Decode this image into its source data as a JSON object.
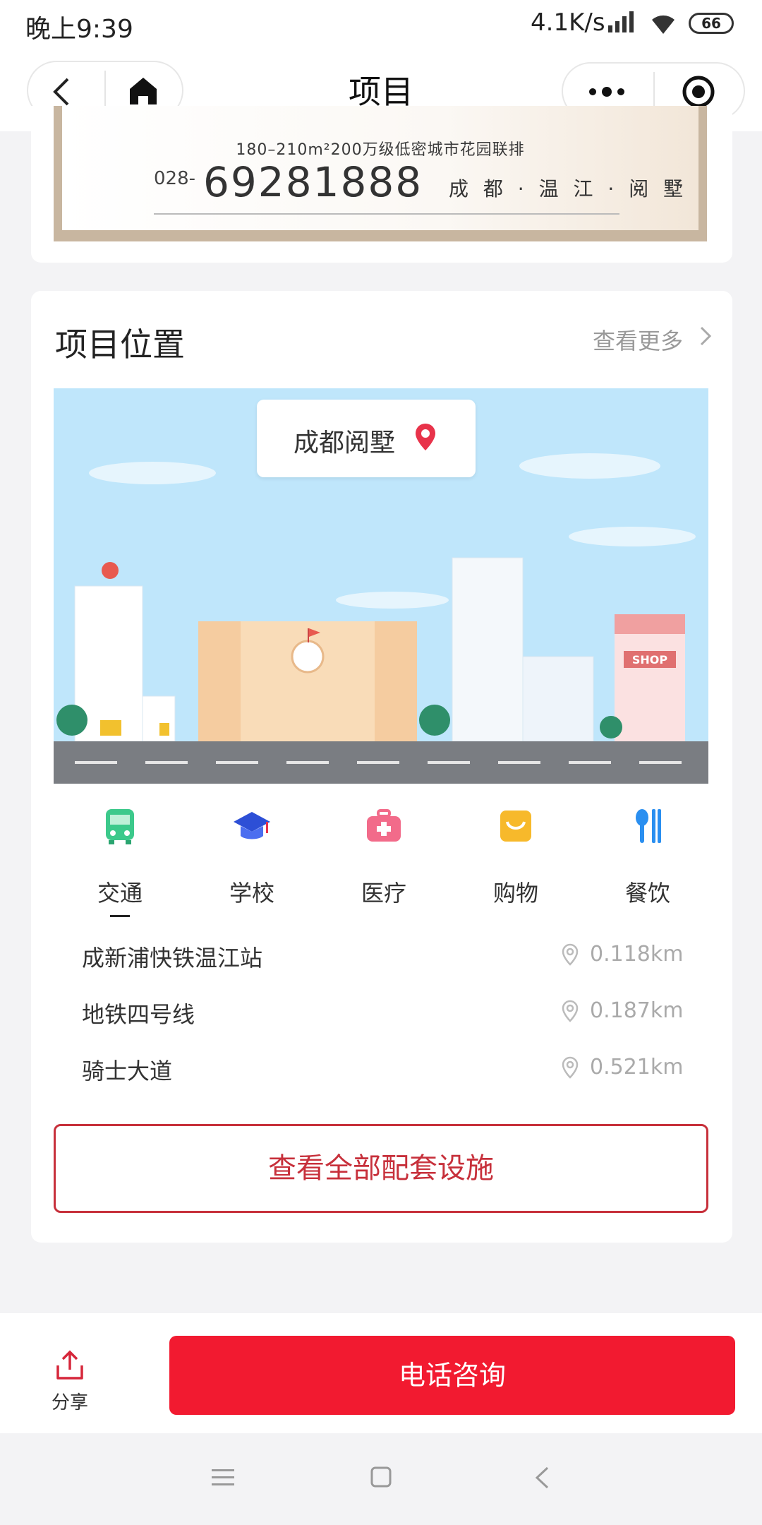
{
  "status_bar": {
    "time": "晚上9:39",
    "speed": "4.1K/s",
    "battery": "66"
  },
  "nav": {
    "title": "项目"
  },
  "banner": {
    "line1": "180–210m²200万级低密城市花园联排",
    "phone_prefix": "028-",
    "phone_main": "69281888",
    "location_text": "成 都 · 温 江 · 阅 墅"
  },
  "location_section": {
    "title": "项目位置",
    "more_label": "查看更多",
    "place_name": "成都阅墅",
    "shop_sign": "SHOP",
    "categories": [
      {
        "label": "交通",
        "icon": "bus-icon"
      },
      {
        "label": "学校",
        "icon": "graduation-cap-icon"
      },
      {
        "label": "医疗",
        "icon": "medical-kit-icon"
      },
      {
        "label": "购物",
        "icon": "shopping-bag-icon"
      },
      {
        "label": "餐饮",
        "icon": "utensils-icon"
      }
    ],
    "selected_category": "交通",
    "places": [
      {
        "name": "成新浦快铁温江站",
        "distance": "0.118km"
      },
      {
        "name": "地铁四号线",
        "distance": "0.187km"
      },
      {
        "name": "骑士大道",
        "distance": "0.521km"
      }
    ],
    "view_all_label": "查看全部配套设施"
  },
  "bottom_bar": {
    "share_label": "分享",
    "call_label": "电话咨询"
  },
  "colors": {
    "accent": "#f21a30",
    "accent_dark": "#c7303b",
    "sky": "#bfe6fb"
  }
}
